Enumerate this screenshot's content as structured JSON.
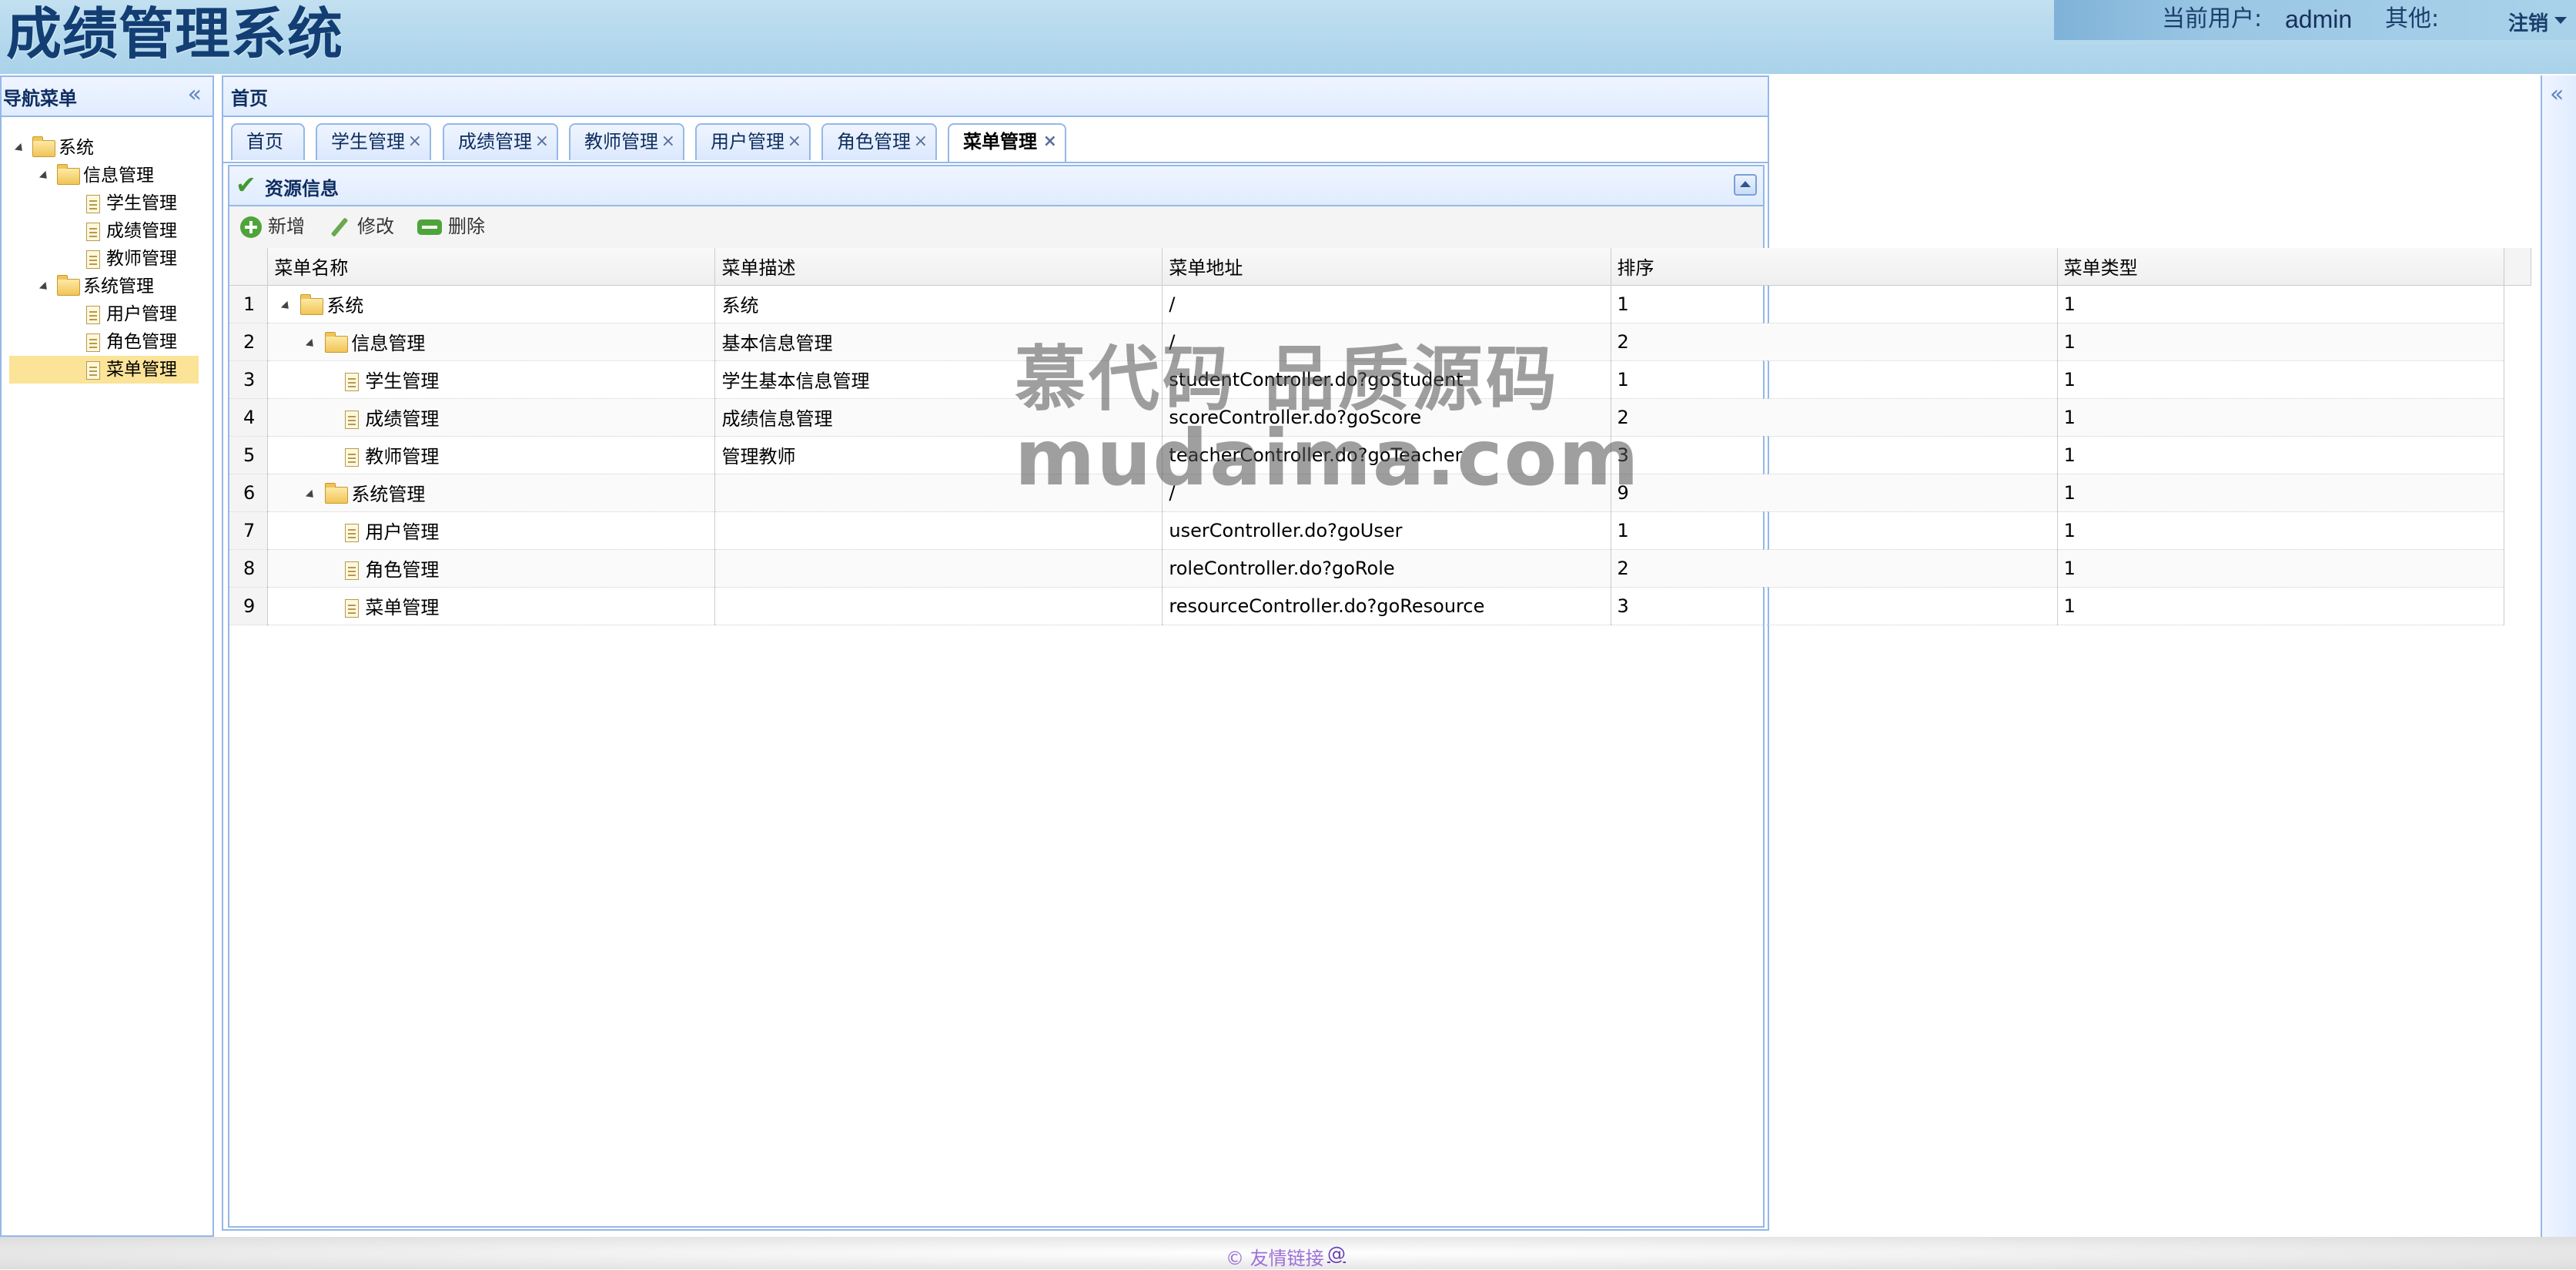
{
  "header": {
    "app_title": "成绩管理系统",
    "current_user_label": "当前用户:",
    "current_user_name": "admin",
    "other_label": "其他:",
    "logout_label": "注销"
  },
  "nav": {
    "title": "导航菜单",
    "tree": [
      {
        "label": "系统",
        "kind": "folder",
        "level": 0,
        "expanded": true
      },
      {
        "label": "信息管理",
        "kind": "folder",
        "level": 1,
        "expanded": true
      },
      {
        "label": "学生管理",
        "kind": "file",
        "level": 2
      },
      {
        "label": "成绩管理",
        "kind": "file",
        "level": 2
      },
      {
        "label": "教师管理",
        "kind": "file",
        "level": 2
      },
      {
        "label": "系统管理",
        "kind": "folder",
        "level": 1,
        "expanded": true
      },
      {
        "label": "用户管理",
        "kind": "file",
        "level": 2
      },
      {
        "label": "角色管理",
        "kind": "file",
        "level": 2
      },
      {
        "label": "菜单管理",
        "kind": "file",
        "level": 2,
        "selected": true
      }
    ]
  },
  "main": {
    "title": "首页",
    "tabs": [
      {
        "label": "首页",
        "closable": false
      },
      {
        "label": "学生管理",
        "closable": true
      },
      {
        "label": "成绩管理",
        "closable": true
      },
      {
        "label": "教师管理",
        "closable": true
      },
      {
        "label": "用户管理",
        "closable": true
      },
      {
        "label": "角色管理",
        "closable": true
      },
      {
        "label": "菜单管理",
        "closable": true,
        "active": true
      }
    ],
    "close_glyph": "×",
    "panel_title": "资源信息",
    "toolbar": {
      "add_label": "新增",
      "edit_label": "修改",
      "delete_label": "删除"
    },
    "grid": {
      "columns": [
        "菜单名称",
        "菜单描述",
        "菜单地址",
        "排序",
        "菜单类型"
      ],
      "rows": [
        {
          "no": "1",
          "name": "系统",
          "kind": "folder",
          "level": 0,
          "desc": "系统",
          "url": "/",
          "sort": "1",
          "type": "1"
        },
        {
          "no": "2",
          "name": "信息管理",
          "kind": "folder",
          "level": 1,
          "desc": "基本信息管理",
          "url": "/",
          "sort": "2",
          "type": "1"
        },
        {
          "no": "3",
          "name": "学生管理",
          "kind": "file",
          "level": 2,
          "desc": "学生基本信息管理",
          "url": "studentController.do?goStudent",
          "sort": "1",
          "type": "1"
        },
        {
          "no": "4",
          "name": "成绩管理",
          "kind": "file",
          "level": 2,
          "desc": "成绩信息管理",
          "url": "scoreController.do?goScore",
          "sort": "2",
          "type": "1"
        },
        {
          "no": "5",
          "name": "教师管理",
          "kind": "file",
          "level": 2,
          "desc": "管理教师",
          "url": "teacherController.do?goTeacher",
          "sort": "3",
          "type": "1"
        },
        {
          "no": "6",
          "name": "系统管理",
          "kind": "folder",
          "level": 1,
          "desc": "",
          "url": "/",
          "sort": "9",
          "type": "1"
        },
        {
          "no": "7",
          "name": "用户管理",
          "kind": "file",
          "level": 2,
          "desc": "",
          "url": "userController.do?goUser",
          "sort": "1",
          "type": "1"
        },
        {
          "no": "8",
          "name": "角色管理",
          "kind": "file",
          "level": 2,
          "desc": "",
          "url": "roleController.do?goRole",
          "sort": "2",
          "type": "1"
        },
        {
          "no": "9",
          "name": "菜单管理",
          "kind": "file",
          "level": 2,
          "desc": "",
          "url": "resourceController.do?goResource",
          "sort": "3",
          "type": "1"
        }
      ]
    }
  },
  "watermark": {
    "line1": "慕代码 品质源码",
    "line2": "mudaima.com"
  },
  "footer": {
    "text": "© 友情链接",
    "link": "@"
  },
  "icons": {
    "collapse_left": "«",
    "collapse_right": "«",
    "check": "✔"
  },
  "colors": {
    "header_bg": "#a9d2ea",
    "panel_border": "#95b8e7",
    "selected_bg": "#fbe398",
    "title_color": "#123e73"
  }
}
